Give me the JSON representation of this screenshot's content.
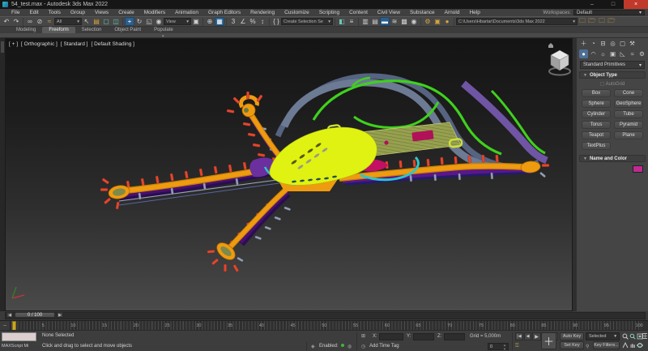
{
  "window": {
    "title": "54_test.max - Autodesk 3ds Max 2022",
    "minimize": "–",
    "maximize": "□",
    "close": "×"
  },
  "menu_bar": {
    "items": [
      "File",
      "Edit",
      "Tools",
      "Group",
      "Views",
      "Create",
      "Modifiers",
      "Animation",
      "Graph Editors",
      "Rendering",
      "Customize",
      "Scripting",
      "Content",
      "Civil View",
      "Substance",
      "Arnold",
      "Help"
    ],
    "workspaces_label": "Workspaces:",
    "workspace_value": "Default"
  },
  "toolbar": {
    "selection_filter_value": "All",
    "ref_coord_value": "View",
    "named_sets_placeholder": "Create Selection Se",
    "project_path": "C:\\Users\\Hbartar\\Documents\\3ds Max 2022"
  },
  "ribbon": {
    "tabs": [
      "Modeling",
      "Freeform",
      "Selection",
      "Object Paint",
      "Populate"
    ],
    "active_tab": "Freeform"
  },
  "viewport": {
    "menu_general": "[ + ]",
    "menu_pov": "[ Orthographic ]",
    "menu_standard": "[ Standard ]",
    "menu_shading": "[ Default Shading ]"
  },
  "command_panel": {
    "category": "Standard Primitives",
    "object_type_title": "Object Type",
    "autogrid_label": "AutoGrid",
    "primitive_buttons": [
      "Box",
      "Cone",
      "Sphere",
      "GeoSphere",
      "Cylinder",
      "Tube",
      "Torus",
      "Pyramid",
      "Teapot",
      "Plane",
      "TextPlus"
    ],
    "name_color_title": "Name and Color",
    "object_color": "#c02a92"
  },
  "timeline": {
    "slider_label": "0 / 100",
    "ticks": [
      "0",
      "5",
      "10",
      "15",
      "20",
      "25",
      "30",
      "35",
      "40",
      "45",
      "50",
      "55",
      "60",
      "65",
      "70",
      "75",
      "80",
      "85",
      "90",
      "95",
      "100"
    ]
  },
  "status_bar": {
    "maxscript_label": "MAXScript Mi",
    "selection_status": "None Selected",
    "prompt": "Click and drag to select and move objects",
    "coord_x_label": "X:",
    "coord_y_label": "Y:",
    "coord_z_label": "Z:",
    "coord_x_value": "",
    "coord_y_value": "",
    "coord_z_value": "",
    "grid_label": "Grid = 5,000m",
    "frame_value": "0",
    "auto_key_label": "Auto Key",
    "set_key_label": "Set Key",
    "selected_value": "Selected",
    "key_filters_label": "Key Filters...",
    "enabled_label": "Enabled:",
    "add_time_tag_label": "Add Time Tag"
  },
  "colors": {
    "accent_blue": "#2d5f8b",
    "model_orange": "#ef9b10",
    "model_red": "#e2472e",
    "model_yellow": "#e0f211",
    "model_green": "#3fd11d",
    "model_cyan": "#2ec7c9",
    "model_purple": "#5b1787",
    "model_slate": "#6d7a94",
    "model_magenta": "#c40f63",
    "close_red": "#c0392b"
  }
}
